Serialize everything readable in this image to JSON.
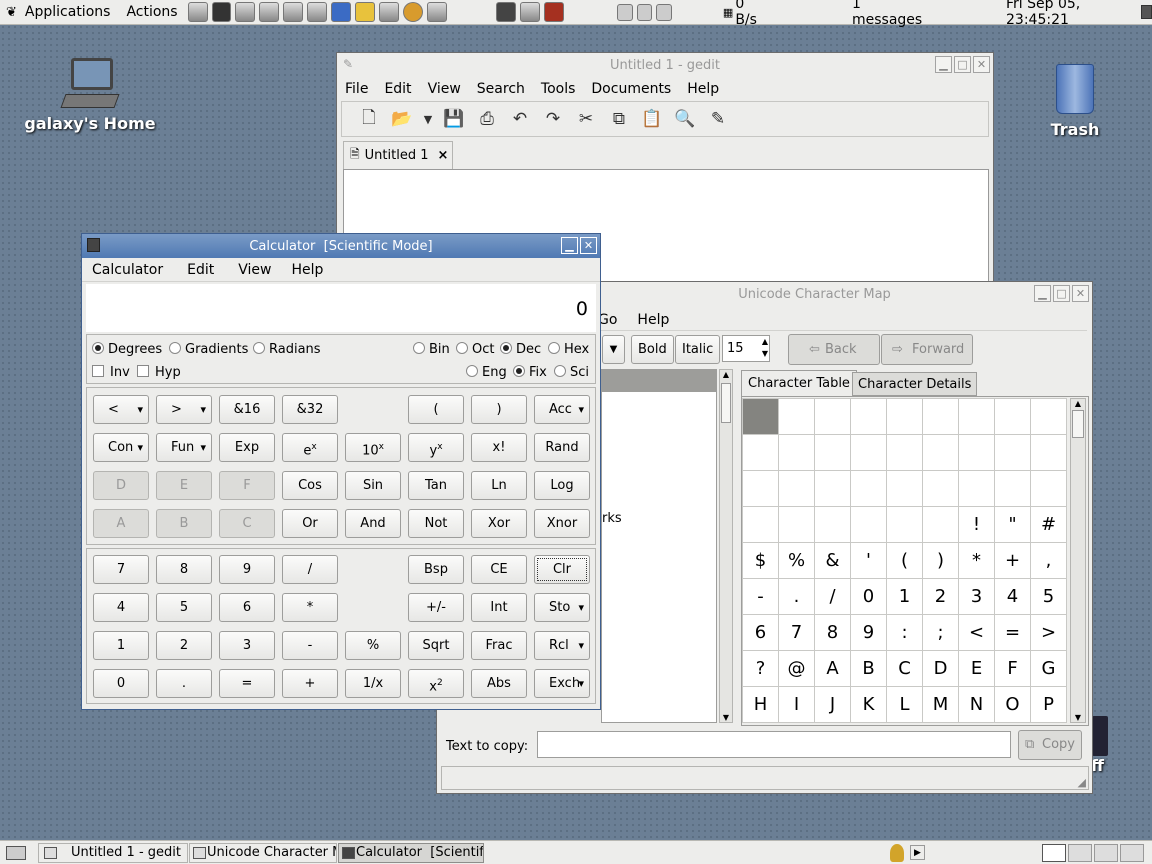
{
  "top_panel": {
    "menus": [
      "Applications",
      "Actions"
    ],
    "network": "0 B/s",
    "messages": "1 messages",
    "clock": "Fri Sep 05, 23:45:21"
  },
  "desktop": {
    "home_label": "galaxy's Home",
    "trash_label": "Trash",
    "partial_label": "ff"
  },
  "gedit": {
    "title": "Untitled 1 - gedit",
    "menus": [
      "File",
      "Edit",
      "View",
      "Search",
      "Tools",
      "Documents",
      "Help"
    ],
    "tab_label": "Untitled 1",
    "tab_close": "×"
  },
  "charmap": {
    "title": "Unicode Character Map",
    "menus": [
      "Go",
      "Help"
    ],
    "bold": "Bold",
    "italic": "Italic",
    "font_size": "15",
    "back": "Back",
    "forward": "Forward",
    "tabs": [
      "Character Table",
      "Character Details"
    ],
    "list_partial": "rks",
    "cells": [
      "",
      "",
      "",
      "",
      "",
      "",
      "",
      "",
      "",
      "",
      "",
      "",
      "",
      "",
      "",
      "",
      "",
      "",
      "",
      "",
      "",
      "",
      "",
      "",
      "",
      "",
      "",
      "",
      "",
      "",
      "",
      "",
      "",
      "!",
      "\"",
      "#",
      "$",
      "%",
      "&",
      "'",
      "(",
      ")",
      "*",
      "+",
      ",",
      "-",
      ".",
      "/",
      "0",
      "1",
      "2",
      "3",
      "4",
      "5",
      "6",
      "7",
      "8",
      "9",
      ":",
      ";",
      "<",
      "=",
      ">",
      "?",
      "@",
      "A",
      "B",
      "C",
      "D",
      "E",
      "F",
      "G",
      "H",
      "I",
      "J",
      "K",
      "L",
      "M",
      "N",
      "O",
      "P"
    ],
    "text_to_copy_label": "Text to copy:",
    "text_to_copy_value": "",
    "copy": "Copy"
  },
  "calculator": {
    "title": "Calculator  [Scientific Mode]",
    "menus": [
      "Calculator",
      "Edit",
      "View",
      "Help"
    ],
    "display": "0",
    "angle_units": [
      "Degrees",
      "Gradients",
      "Radians"
    ],
    "bases": [
      "Bin",
      "Oct",
      "Dec",
      "Hex"
    ],
    "toggles": [
      "Inv",
      "Hyp"
    ],
    "notation": [
      "Eng",
      "Fix",
      "Sci"
    ],
    "sci_rows": [
      [
        "<",
        ">",
        "&16",
        "&32",
        "",
        "(",
        ")",
        "Acc"
      ],
      [
        "Con",
        "Fun",
        "Exp",
        "e^x",
        "10^x",
        "y^x",
        "x!",
        "Rand"
      ],
      [
        "D",
        "E",
        "F",
        "Cos",
        "Sin",
        "Tan",
        "Ln",
        "Log"
      ],
      [
        "A",
        "B",
        "C",
        "Or",
        "And",
        "Not",
        "Xor",
        "Xnor"
      ]
    ],
    "basic_rows": [
      [
        "7",
        "8",
        "9",
        "/",
        "",
        "Bsp",
        "CE",
        "Clr"
      ],
      [
        "4",
        "5",
        "6",
        "*",
        "",
        "+/-",
        "Int",
        "Sto"
      ],
      [
        "1",
        "2",
        "3",
        "-",
        "%",
        "Sqrt",
        "Frac",
        "Rcl"
      ],
      [
        "0",
        ".",
        "=",
        "+",
        "1/x",
        "x^2",
        "Abs",
        "Exch"
      ]
    ]
  },
  "taskbar": {
    "tasks": [
      "Untitled 1 - gedit",
      "Unicode Character M",
      "Calculator  [Scientific"
    ]
  }
}
